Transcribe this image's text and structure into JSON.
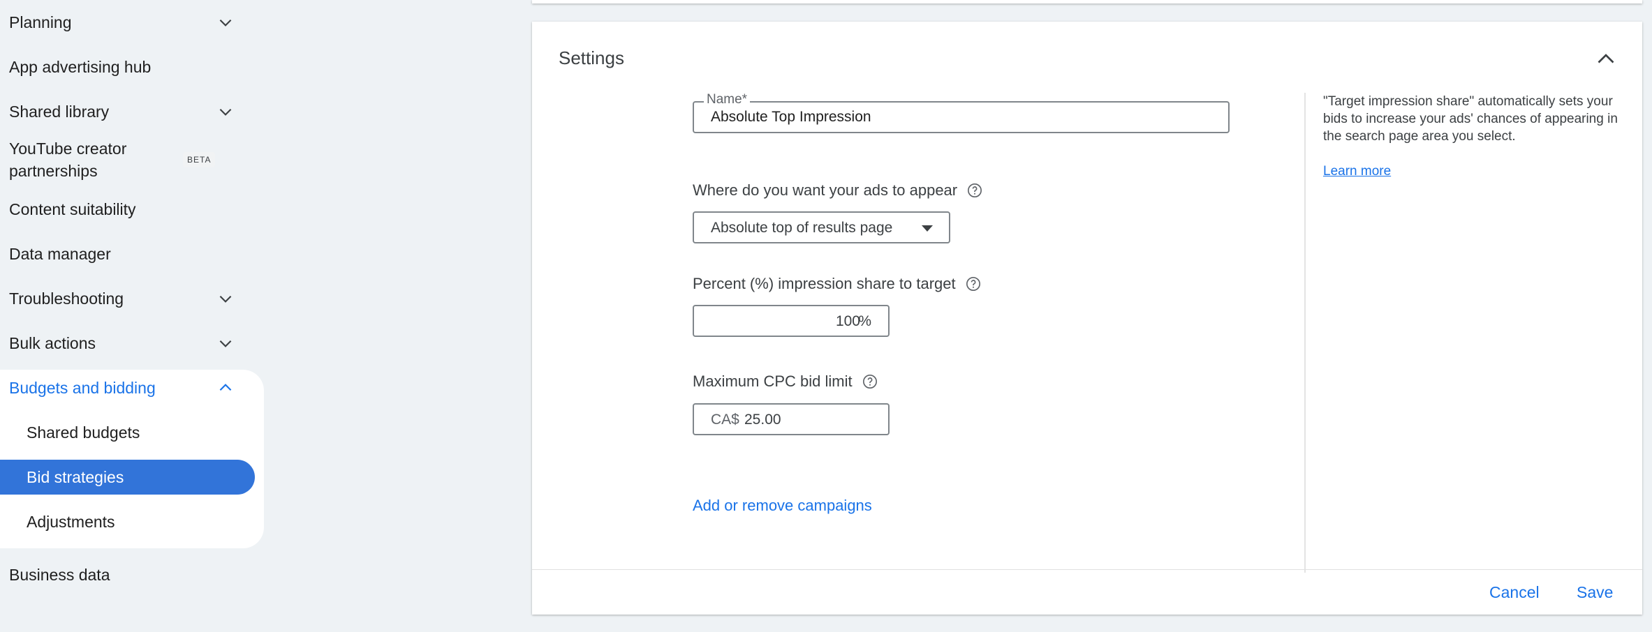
{
  "sidebar": {
    "items": {
      "planning": "Planning",
      "app_hub": "App advertising hub",
      "shared_library": "Shared library",
      "youtube": "YouTube creator partnerships",
      "beta": "BETA",
      "content_suitability": "Content suitability",
      "data_manager": "Data manager",
      "troubleshooting": "Troubleshooting",
      "bulk_actions": "Bulk actions",
      "budgets": "Budgets and bidding",
      "shared_budgets": "Shared budgets",
      "bid_strategies": "Bid strategies",
      "adjustments": "Adjustments",
      "business_data": "Business data"
    },
    "selected": "Bid strategies"
  },
  "settings": {
    "title": "Settings",
    "name_label": "Name*",
    "name_value": "Absolute Top Impression",
    "where_label": "Where do you want your ads to appear",
    "where_value": "Absolute top of results page",
    "percent_label": "Percent (%) impression share to target",
    "percent_value": "100",
    "percent_suffix": "%",
    "cpc_label": "Maximum CPC bid limit",
    "cpc_prefix": "CA$",
    "cpc_value": "25.00",
    "add_campaigns": "Add or remove campaigns",
    "help_text": "\"Target impression share\" automatically sets your bids to increase your ads' chances of appearing in the search page area you select.",
    "learn_more": "Learn more",
    "cancel": "Cancel",
    "save": "Save"
  },
  "colors": {
    "accent": "#1a73e8",
    "selected_bg": "#3274d9",
    "page_bg": "#eef2f5"
  }
}
